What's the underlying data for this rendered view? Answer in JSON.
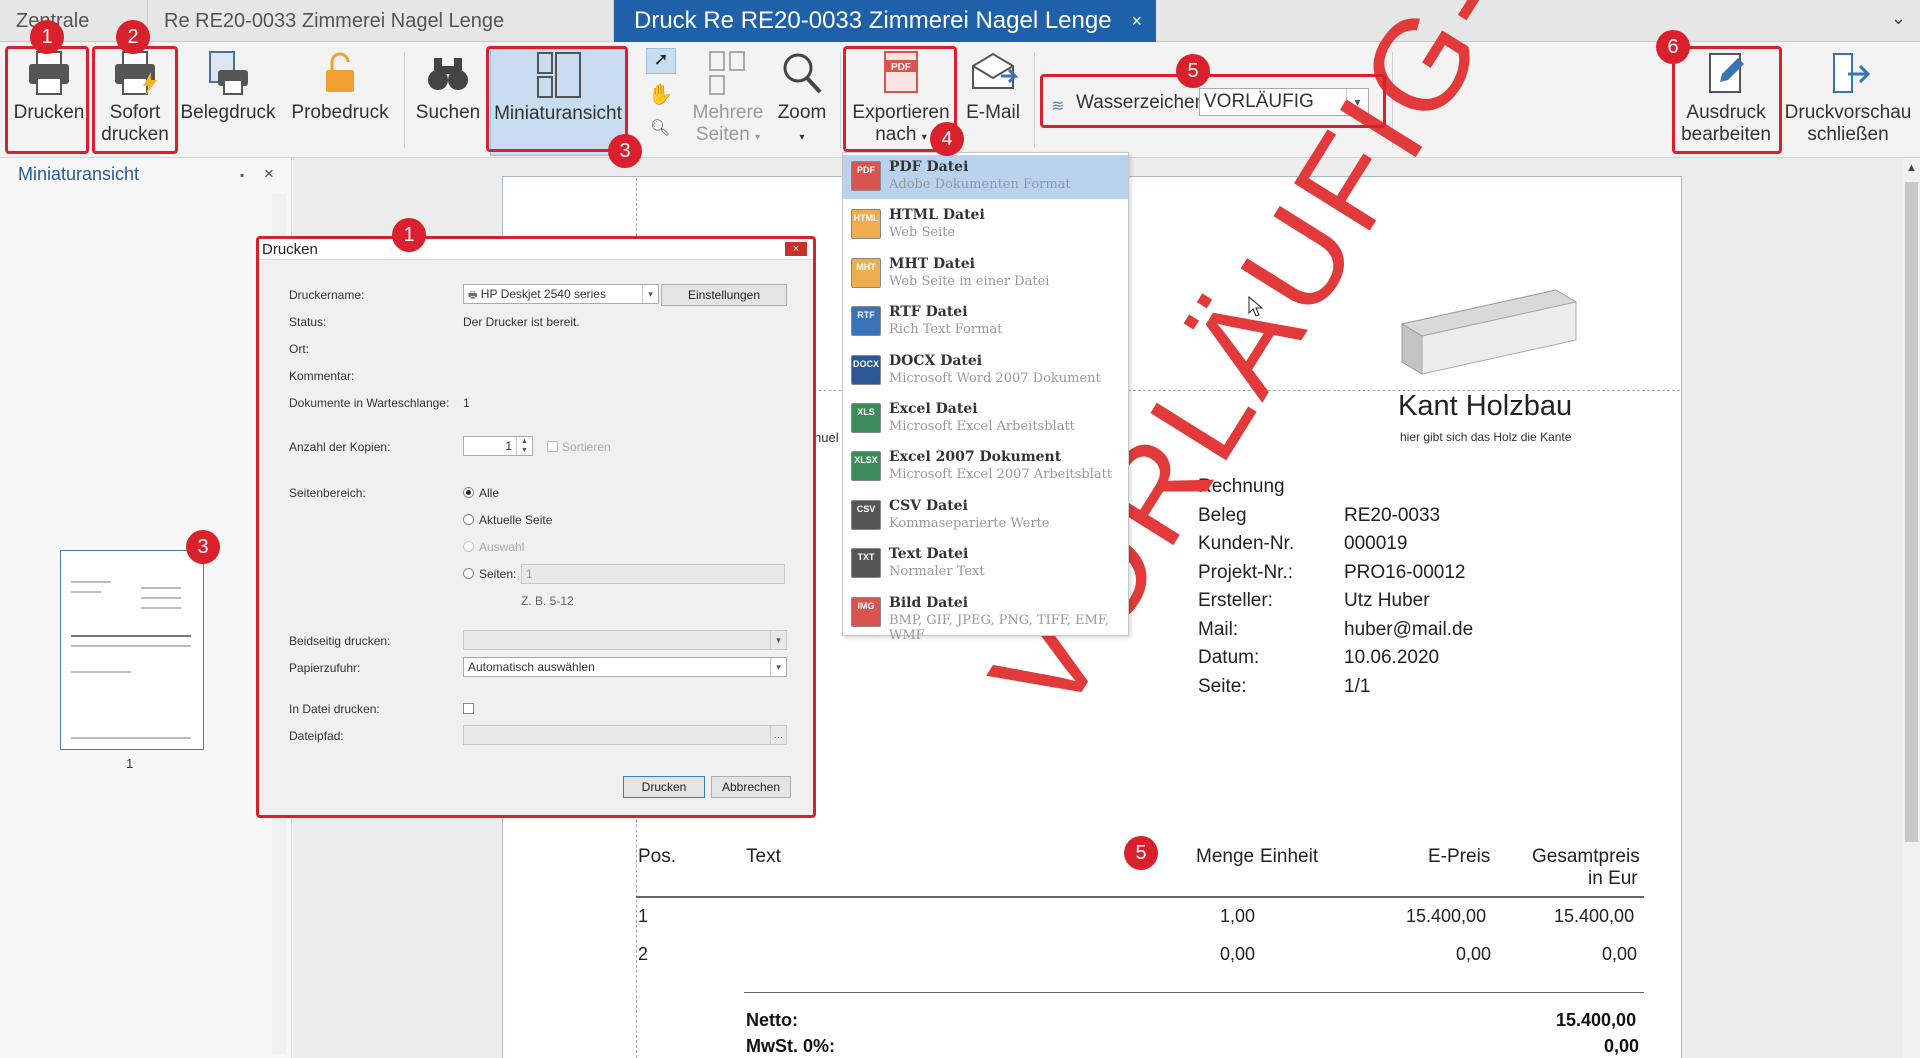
{
  "tabs": [
    {
      "label": "Zentrale"
    },
    {
      "label": "Re RE20-0033 Zimmerei Nagel Lenge"
    },
    {
      "label": "Druck Re RE20-0033 Zimmerei Nagel Lenge",
      "close": "×"
    }
  ],
  "ribbon": {
    "drucken": "Drucken",
    "sofort1": "Sofort",
    "sofort2": "drucken",
    "belegdruck": "Belegdruck",
    "probedruck": "Probedruck",
    "suchen": "Suchen",
    "miniatur": "Miniaturansicht",
    "mehrere1": "Mehrere",
    "mehrere2": "Seiten",
    "zoom": "Zoom",
    "export1": "Exportieren",
    "export2": "nach",
    "email": "E-Mail",
    "wasserzeichen_label": "Wasserzeichen",
    "wasserzeichen_value": "VORLÄUFIG",
    "ausdruck1": "Ausdruck",
    "ausdruck2": "bearbeiten",
    "schliessen1": "Druckvorschau",
    "schliessen2": "schließen"
  },
  "badges": [
    "1",
    "2",
    "3",
    "4",
    "5",
    "6"
  ],
  "left_panel": {
    "title": "Miniaturansicht",
    "page_number": "1"
  },
  "export_menu": [
    {
      "tag": "PDF",
      "name": "PDF Datei",
      "desc": "Adobe Dokumenten Format",
      "color": "#d9534f"
    },
    {
      "tag": "HTML",
      "name": "HTML Datei",
      "desc": "Web Seite",
      "color": "#f0ad4e"
    },
    {
      "tag": "MHT",
      "name": "MHT Datei",
      "desc": "Web Seite in einer Datei",
      "color": "#f0ad4e"
    },
    {
      "tag": "RTF",
      "name": "RTF Datei",
      "desc": "Rich Text Format",
      "color": "#3a72b8"
    },
    {
      "tag": "DOCX",
      "name": "DOCX Datei",
      "desc": "Microsoft Word 2007 Dokument",
      "color": "#2b5797"
    },
    {
      "tag": "XLS",
      "name": "Excel Datei",
      "desc": "Microsoft Excel Arbeitsblatt",
      "color": "#3c8d5a"
    },
    {
      "tag": "XLSX",
      "name": "Excel 2007 Dokument",
      "desc": "Microsoft Excel 2007 Arbeitsblatt",
      "color": "#3c8d5a"
    },
    {
      "tag": "CSV",
      "name": "CSV Datei",
      "desc": "Kommaseparierte Werte",
      "color": "#555555"
    },
    {
      "tag": "TXT",
      "name": "Text Datei",
      "desc": "Normaler Text",
      "color": "#555555"
    },
    {
      "tag": "IMG",
      "name": "Bild Datei",
      "desc": "BMP, GIF, JPEG, PNG, TIFF, EMF, WMF",
      "color": "#d9534f"
    }
  ],
  "dialog": {
    "title": "Drucken",
    "close": "×",
    "druckername_label": "Druckername:",
    "druckername_value": "HP Deskjet 2540 series",
    "einstellungen": "Einstellungen",
    "status_label": "Status:",
    "status_value": "Der Drucker ist bereit.",
    "ort_label": "Ort:",
    "kommentar_label": "Kommentar:",
    "warteschlange_label": "Dokumente in Warteschlange:",
    "warteschlange_value": "1",
    "kopien_label": "Anzahl der Kopien:",
    "kopien_value": "1",
    "sortieren": "Sortieren",
    "seitenbereich_label": "Seitenbereich:",
    "alle": "Alle",
    "aktuelle_seite": "Aktuelle Seite",
    "auswahl": "Auswahl",
    "seiten": "Seiten:",
    "seiten_value": "1",
    "seiten_hint": "Z. B. 5-12",
    "beidseitig_label": "Beidseitig drucken:",
    "papierzufuhr_label": "Papierzufuhr:",
    "papierzufuhr_value": "Automatisch auswählen",
    "in_datei_label": "In Datei drucken:",
    "dateipfad_label": "Dateipfad:",
    "drucken_btn": "Drucken",
    "abbrechen_btn": "Abbrechen"
  },
  "document": {
    "company": "Kant Holzbau",
    "slogan": "hier gibt sich das Holz die Kante",
    "partial_text": "nuel",
    "info": [
      {
        "k": "Rechnung",
        "v": ""
      },
      {
        "k": "Beleg",
        "v": "RE20-0033"
      },
      {
        "k": "Kunden-Nr.",
        "v": "000019"
      },
      {
        "k": "Projekt-Nr.:",
        "v": "PRO16-00012"
      },
      {
        "k": "Ersteller:",
        "v": "Utz Huber"
      },
      {
        "k": "Mail:",
        "v": "huber@mail.de"
      },
      {
        "k": "Datum:",
        "v": "10.06.2020"
      },
      {
        "k": "Seite:",
        "v": "1/1"
      }
    ],
    "table_headers": {
      "pos": "Pos.",
      "text": "Text",
      "menge": "Menge",
      "einheit": "Einheit",
      "epreis": "E-Preis",
      "gesamt1": "Gesamtpreis",
      "gesamt2": "in Eur"
    },
    "rows": [
      {
        "pos": "1",
        "menge": "1,00",
        "epreis": "15.400,00",
        "gesamt": "15.400,00"
      },
      {
        "pos": "2",
        "menge": "0,00",
        "epreis": "0,00",
        "gesamt": "0,00"
      }
    ],
    "netto_label": "Netto:",
    "netto_value": "15.400,00",
    "mwst_label": "MwSt. 0%:",
    "mwst_value": "0,00",
    "watermark": "VORLÄUFIG-"
  },
  "colors": {
    "accent": "#1f61a8",
    "annotation": "#d9202c",
    "watermark": "#e23a3a"
  }
}
